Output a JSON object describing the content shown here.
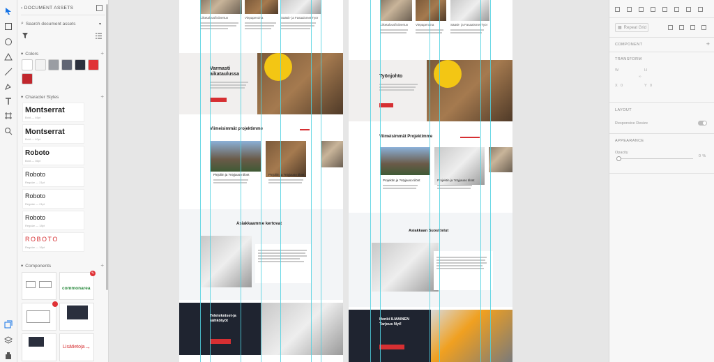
{
  "assets": {
    "title": "DOCUMENT ASSETS",
    "search_placeholder": "Search document assets",
    "colors_label": "Colors",
    "colors": [
      "#ffffff",
      "#f2f2f2",
      "#9a9da3",
      "#606574",
      "#2b2f3d",
      "#e03236",
      "#c1272d"
    ],
    "character_styles_label": "Character Styles",
    "character_styles": [
      {
        "name": "Montserrat",
        "sub": "Bold — 46pt"
      },
      {
        "name": "Montserrat",
        "sub": "Bold — 40pt"
      },
      {
        "name": "Roboto",
        "sub": "Bold — 36pt"
      },
      {
        "name": "Roboto",
        "sub": "Regular — 21pt"
      },
      {
        "name": "Roboto",
        "sub": "Regular — 21pt"
      },
      {
        "name": "Roboto",
        "sub": "Regular — 18pt"
      },
      {
        "name": "ROBOTO",
        "sub": "Regular — 16pt"
      }
    ],
    "components_label": "Components",
    "component_brand": "commonarea",
    "component_link": "Lisätietoja"
  },
  "props": {
    "repeat_grid": "Repeat Grid",
    "component": "COMPONENT",
    "transform": "TRANSFORM",
    "w": "W",
    "h": "H",
    "x": "X",
    "y": "Y",
    "x_val": "0",
    "y_val": "0",
    "layout": "LAYOUT",
    "responsive_resize": "Responsive Resize",
    "appearance": "APPEARANCE",
    "opacity_label": "Opacity",
    "opacity_val": "0 %"
  },
  "artboard_left": {
    "cols": [
      "Liiketalousfisiivertun",
      "Viepaperoina",
      "Sääsit- ja Fasaaismet Työr"
    ],
    "hero_title": "Varmasti aikataulussa",
    "projects_heading": "Viimeisimmät projektimme",
    "project_card_title": "Pinjoliin ja ?ntyjauso tilönt",
    "testimonials_heading": "Asiakkaamme kertovat",
    "cta_title": "Teletekniset-ja sähkötyöt",
    "cta_button": "Pyydä tarjous"
  },
  "artboard_right": {
    "cols": [
      "Liiketalousfisiivertun",
      "Viepaperoina",
      "Sääsit- ja Fasaaismet Työr"
    ],
    "hero_title": "Työnjohto",
    "projects_heading": "Viimeisimmät Projektimme",
    "project_card_title": "Projektin ja ?ntyjauso tilönt",
    "testimonials_heading": "Asiakkaan Suosittelut",
    "cta_title": "Henki ILMAINEN Tarjous Nyt!",
    "cta_button": "Pyydä tarjous"
  }
}
